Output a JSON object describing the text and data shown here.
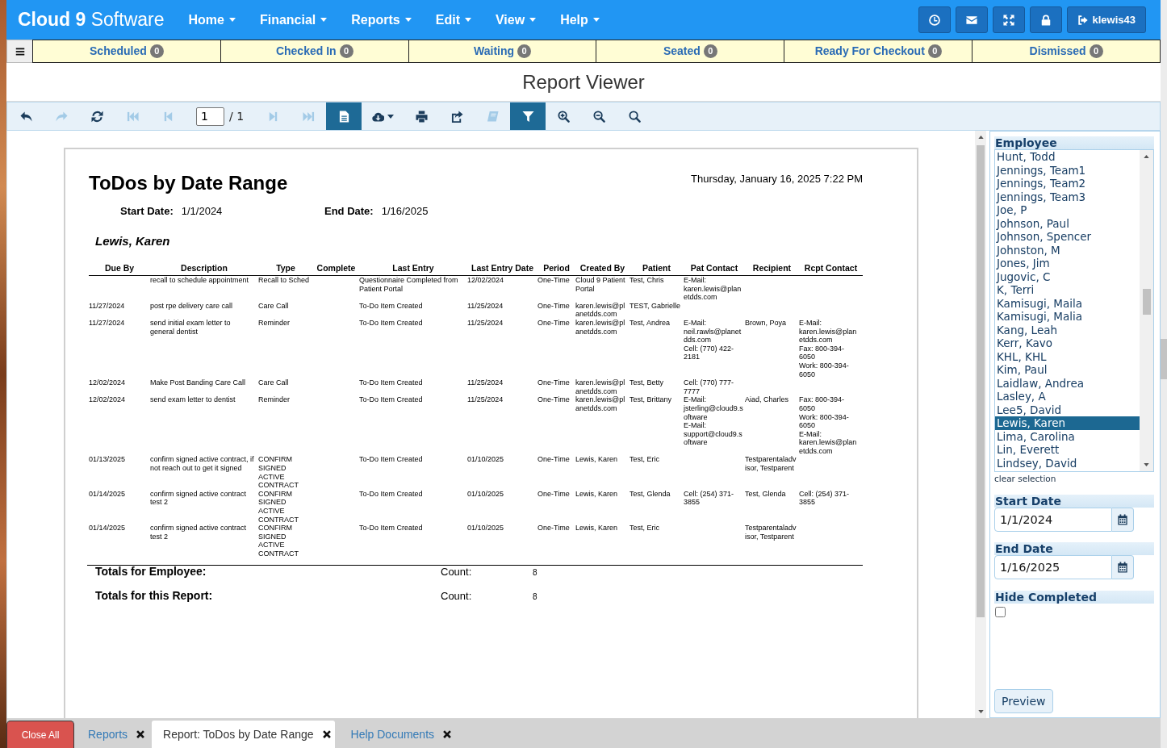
{
  "header": {
    "brand": "**Cloud 9** Software",
    "menu": [
      "Home",
      "Financial",
      "Reports",
      "Edit",
      "View",
      "Help"
    ],
    "user": "klewis43"
  },
  "status_tabs": [
    {
      "label": "Scheduled",
      "count": "0"
    },
    {
      "label": "Checked In",
      "count": "0"
    },
    {
      "label": "Waiting",
      "count": "0"
    },
    {
      "label": "Seated",
      "count": "0"
    },
    {
      "label": "Ready For Checkout",
      "count": "0"
    },
    {
      "label": "Dismissed",
      "count": "0"
    }
  ],
  "page_title": "Report Viewer",
  "toolbar": {
    "buttons_before_page": [
      {
        "kind": "undo",
        "disabled": false,
        "on": false
      },
      {
        "kind": "redo",
        "disabled": true,
        "on": false
      },
      {
        "kind": "refresh",
        "disabled": false,
        "on": false
      },
      {
        "kind": "first",
        "disabled": true,
        "on": false
      },
      {
        "kind": "previous",
        "disabled": true,
        "on": false
      }
    ],
    "page_field": "1",
    "page_count": "/ 1",
    "buttons_after_page": [
      {
        "kind": "next",
        "disabled": true,
        "on": false
      },
      {
        "kind": "last",
        "disabled": true,
        "on": false
      },
      {
        "kind": "document",
        "disabled": false,
        "on": true
      },
      {
        "kind": "download",
        "disabled": false,
        "on": false
      },
      {
        "kind": "print",
        "disabled": false,
        "on": false
      },
      {
        "kind": "export",
        "disabled": false,
        "on": false
      },
      {
        "kind": "book",
        "disabled": true,
        "on": false
      },
      {
        "kind": "filter",
        "disabled": false,
        "on": true
      },
      {
        "kind": "zoom_in",
        "disabled": false,
        "on": false
      },
      {
        "kind": "zoom_out",
        "disabled": false,
        "on": false
      },
      {
        "kind": "search",
        "disabled": false,
        "on": false
      }
    ]
  },
  "report": {
    "title": "ToDos by Date Range",
    "printed_at": "Thursday, January 16, 2025 7:22 PM",
    "parameters": [
      {
        "label": "Start Date:",
        "value": "1/1/2024"
      },
      {
        "label": "End Date:",
        "value": "1/16/2025"
      }
    ],
    "group": "Lewis, Karen",
    "columns": [
      "Due By",
      "Description",
      "Type",
      "Complete",
      "Last Entry",
      "Last Entry Date",
      "Period",
      "Created By",
      "Patient",
      "Pat Contact",
      "Recipient",
      "Rcpt Contact"
    ],
    "rows": [
      {
        "description": "recall to schedule appointment",
        "type": "Recall to Sched",
        "last_entry": "Questionnaire Completed from Patient Portal",
        "last_entry_date": "12/02/2024",
        "period": "One-Time",
        "created_by": "Cloud 9 Patient Portal",
        "patient": "Test, Chris",
        "pat_contact": [
          "E-Mail: karen.lewis@planetdds.com"
        ]
      },
      {
        "due_by": "11/27/2024",
        "description": "post rpe delivery care call",
        "type": "Care Call",
        "last_entry": "To-Do Item Created",
        "last_entry_date": "11/25/2024",
        "period": "One-Time",
        "created_by": "karen.lewis@planetdds.com",
        "patient": "TEST, Gabrielle"
      },
      {
        "due_by": "11/27/2024",
        "description": "send initial exam letter to general dentist",
        "type": "Reminder",
        "last_entry": "To-Do Item Created",
        "last_entry_date": "11/25/2024",
        "period": "One-Time",
        "created_by": "karen.lewis@planetdds.com",
        "patient": "Test, Andrea",
        "pat_contact": [
          "E-Mail: neil.rawls@planetdds.com",
          "Cell: (770) 422-2181"
        ],
        "recipient": "Brown, Poya",
        "rcpt_contact": [
          "E-Mail: karen.lewis@planetdds.com",
          "Fax: 800-394-6050",
          "Work: 800-394-6050"
        ]
      },
      {
        "due_by": "12/02/2024",
        "description": "Make Post Banding Care Call",
        "type": "Care Call",
        "last_entry": "To-Do Item Created",
        "last_entry_date": "11/25/2024",
        "period": "One-Time",
        "created_by": "karen.lewis@planetdds.com",
        "patient": "Test, Betty",
        "pat_contact": [
          "Cell: (770) 777-7777"
        ]
      },
      {
        "due_by": "12/02/2024",
        "description": "send exam letter to dentist",
        "type": "Reminder",
        "last_entry": "To-Do Item Created",
        "last_entry_date": "11/25/2024",
        "period": "One-Time",
        "created_by": "karen.lewis@planetdds.com",
        "patient": "Test, Brittany",
        "pat_contact": [
          "E-Mail: jsterling@cloud9.software",
          "E-Mail: support@cloud9.software"
        ],
        "recipient": "Aiad, Charles",
        "rcpt_contact": [
          "Fax: 800-394-6050",
          "Work: 800-394-6050",
          "E-Mail: karen.lewis@planetdds.com"
        ]
      },
      {
        "due_by": "01/13/2025",
        "description": "confirm signed active contract, if not reach out to get it signed",
        "type": "CONFIRM SIGNED ACTIVE CONTRACT",
        "last_entry": "To-Do Item Created",
        "last_entry_date": "01/10/2025",
        "period": "One-Time",
        "created_by": "Lewis, Karen",
        "patient": "Test, Eric",
        "recipient": "Testparentaladvisor, Testparent"
      },
      {
        "due_by": "01/14/2025",
        "description": "confirm signed active contract test 2",
        "type": "CONFIRM SIGNED ACTIVE CONTRACT",
        "last_entry": "To-Do Item Created",
        "last_entry_date": "01/10/2025",
        "period": "One-Time",
        "created_by": "Lewis, Karen",
        "patient": "Test, Glenda",
        "pat_contact": [
          "Cell: (254) 371-3855"
        ],
        "recipient": "Test, Glenda",
        "rcpt_contact": [
          "Cell: (254) 371-3855"
        ]
      },
      {
        "due_by": "01/14/2025",
        "description": "confirm signed active contract test 2",
        "type": "CONFIRM SIGNED ACTIVE CONTRACT",
        "last_entry": "To-Do Item Created",
        "last_entry_date": "01/10/2025",
        "period": "One-Time",
        "created_by": "Lewis, Karen",
        "patient": "Test, Eric",
        "recipient": "Testparentaladvisor, Testparent"
      }
    ],
    "totals": [
      {
        "label": "Totals for Employee:",
        "count_label": "Count:",
        "count": "8"
      },
      {
        "label": "Totals for this Report:",
        "count_label": "Count:",
        "count": "8"
      }
    ]
  },
  "parameters_panel": {
    "employee": {
      "label": "Employee",
      "options": [
        {
          "label": "Hunt, Todd",
          "selected": false
        },
        {
          "label": "Jennings, Team1",
          "selected": false
        },
        {
          "label": "Jennings, Team2",
          "selected": false
        },
        {
          "label": "Jennings, Team3",
          "selected": false
        },
        {
          "label": "Joe, P",
          "selected": false
        },
        {
          "label": "Johnson, Paul",
          "selected": false
        },
        {
          "label": "Johnson, Spencer",
          "selected": false
        },
        {
          "label": "Johnston, M",
          "selected": false
        },
        {
          "label": "Jones, Jim",
          "selected": false
        },
        {
          "label": "Jugovic, C",
          "selected": false
        },
        {
          "label": "K, Terri",
          "selected": false
        },
        {
          "label": "Kamisugi, Maila",
          "selected": false
        },
        {
          "label": "Kamisugi, Malia",
          "selected": false
        },
        {
          "label": "Kang, Leah",
          "selected": false
        },
        {
          "label": "Kerr, Kavo",
          "selected": false
        },
        {
          "label": "KHL, KHL",
          "selected": false
        },
        {
          "label": "Kim, Paul",
          "selected": false
        },
        {
          "label": "Laidlaw, Andrea",
          "selected": false
        },
        {
          "label": "Lasley, A",
          "selected": false
        },
        {
          "label": "Lee5, David",
          "selected": false
        },
        {
          "label": "Lewis, Karen",
          "selected": true
        },
        {
          "label": "Lima, Carolina",
          "selected": false
        },
        {
          "label": "Lin, Everett",
          "selected": false
        },
        {
          "label": "Lindsey, David",
          "selected": false
        }
      ],
      "clear_link": "clear selection"
    },
    "start_date": {
      "label": "Start Date",
      "value": "1/1/2024"
    },
    "end_date": {
      "label": "End Date",
      "value": "1/16/2025"
    },
    "hide_completed": {
      "label": "Hide Completed",
      "checked": false
    },
    "preview_button": "Preview"
  },
  "close_all": "Close All",
  "document_tabs": [
    {
      "label": "Reports",
      "selected": false
    },
    {
      "label": "Report: ToDos by Date Range",
      "selected": true
    },
    {
      "label": "Help Documents",
      "selected": false
    }
  ]
}
